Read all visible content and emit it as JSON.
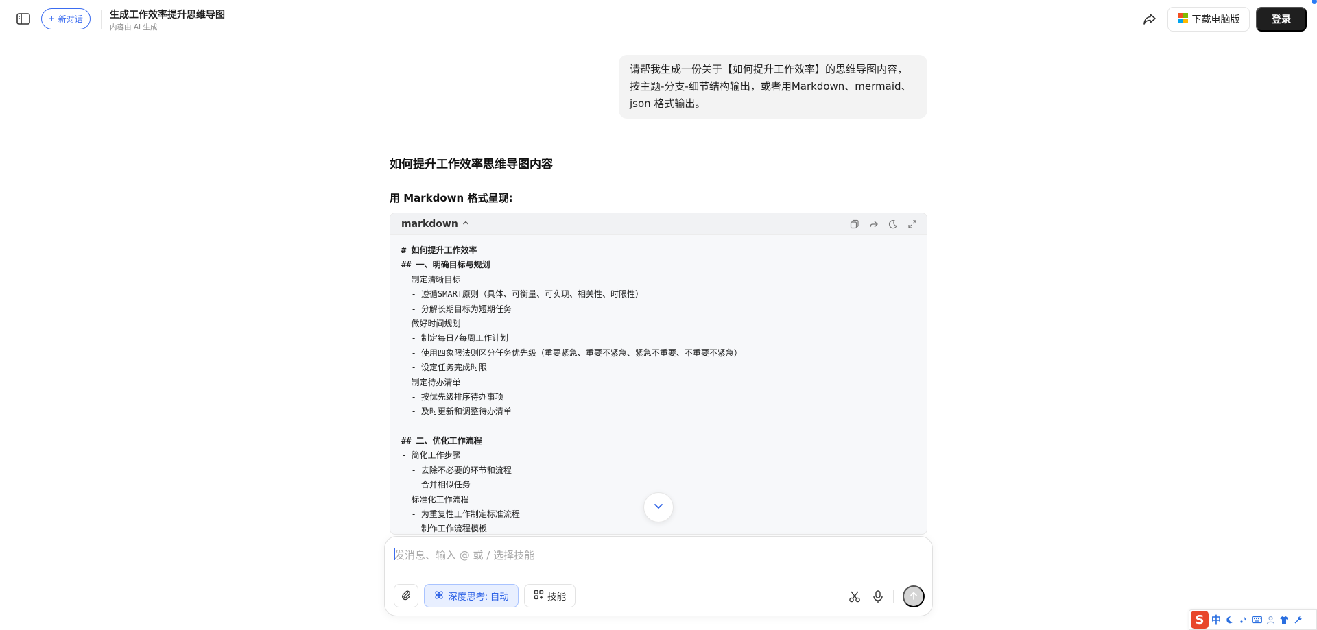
{
  "header": {
    "new_chat_label": "新对话",
    "conversation_title": "生成工作效率提升思维导图",
    "conversation_subtitle": "内容由 AI 生成",
    "download_label": "下载电脑版",
    "login_label": "登录"
  },
  "user_message": "请帮我生成一份关于【如何提升工作效率】的思维导图内容，按主题-分支-细节结构输出，或者用Markdown、mermaid、json 格式输出。",
  "answer": {
    "title": "如何提升工作效率思维导图内容",
    "subtitle": "用 Markdown 格式呈现:",
    "code_language": "markdown",
    "code_lines": [
      {
        "text": "# 如何提升工作效率",
        "bold": true
      },
      {
        "text": "## 一、明确目标与规划",
        "bold": true
      },
      {
        "text": "- 制定清晰目标",
        "bold": false
      },
      {
        "text": "  - 遵循SMART原则（具体、可衡量、可实现、相关性、时限性）",
        "bold": false
      },
      {
        "text": "  - 分解长期目标为短期任务",
        "bold": false
      },
      {
        "text": "- 做好时间规划",
        "bold": false
      },
      {
        "text": "  - 制定每日/每周工作计划",
        "bold": false
      },
      {
        "text": "  - 使用四象限法则区分任务优先级（重要紧急、重要不紧急、紧急不重要、不重要不紧急）",
        "bold": false
      },
      {
        "text": "  - 设定任务完成时限",
        "bold": false
      },
      {
        "text": "- 制定待办清单",
        "bold": false
      },
      {
        "text": "  - 按优先级排序待办事项",
        "bold": false
      },
      {
        "text": "  - 及时更新和调整待办清单",
        "bold": false
      },
      {
        "text": "",
        "bold": false
      },
      {
        "text": "## 二、优化工作流程",
        "bold": true
      },
      {
        "text": "- 简化工作步骤",
        "bold": false
      },
      {
        "text": "  - 去除不必要的环节和流程",
        "bold": false
      },
      {
        "text": "  - 合并相似任务",
        "bold": false
      },
      {
        "text": "- 标准化工作流程",
        "bold": false
      },
      {
        "text": "  - 为重复性工作制定标准流程",
        "bold": false
      },
      {
        "text": "  - 制作工作流程模板",
        "bold": false
      }
    ]
  },
  "composer": {
    "placeholder": "发消息、输入 @ 或 / 选择技能",
    "deep_think_label": "深度思考: 自动",
    "skill_label": "技能"
  },
  "ime": {
    "logo": "S",
    "mode": "中"
  },
  "colors": {
    "accent": "#3b6cf0",
    "login_bg": "#1f1f1f",
    "ime_red": "#e8472b"
  }
}
